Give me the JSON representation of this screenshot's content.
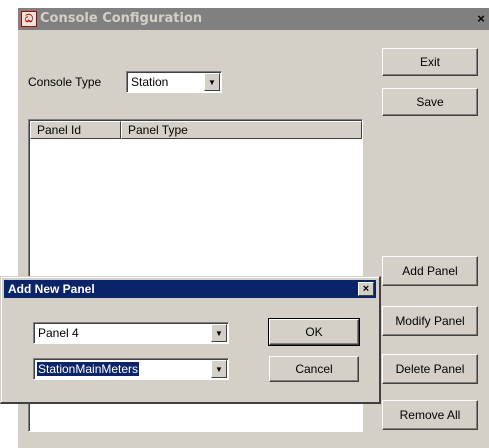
{
  "window": {
    "title": "Console Configuration",
    "icon": "app-icon",
    "icon_glyph": "ඏ",
    "close_glyph": "×"
  },
  "console_type": {
    "label": "Console Type",
    "value": "Station",
    "arrow": "▼"
  },
  "buttons": {
    "exit": "Exit",
    "save": "Save",
    "add_panel": "Add Panel",
    "modify_panel": "Modify Panel",
    "delete_panel": "Delete Panel",
    "remove_all": "Remove All"
  },
  "panel_list": {
    "columns": [
      "Panel Id",
      "Panel Type"
    ],
    "rows": []
  },
  "dialog": {
    "title": "Add New Panel",
    "close_glyph": "×",
    "panel_name": {
      "value": "Panel 4",
      "arrow": "▼"
    },
    "panel_type": {
      "value": "StationMainMeters",
      "arrow": "▼"
    },
    "ok": "OK",
    "cancel": "Cancel"
  }
}
